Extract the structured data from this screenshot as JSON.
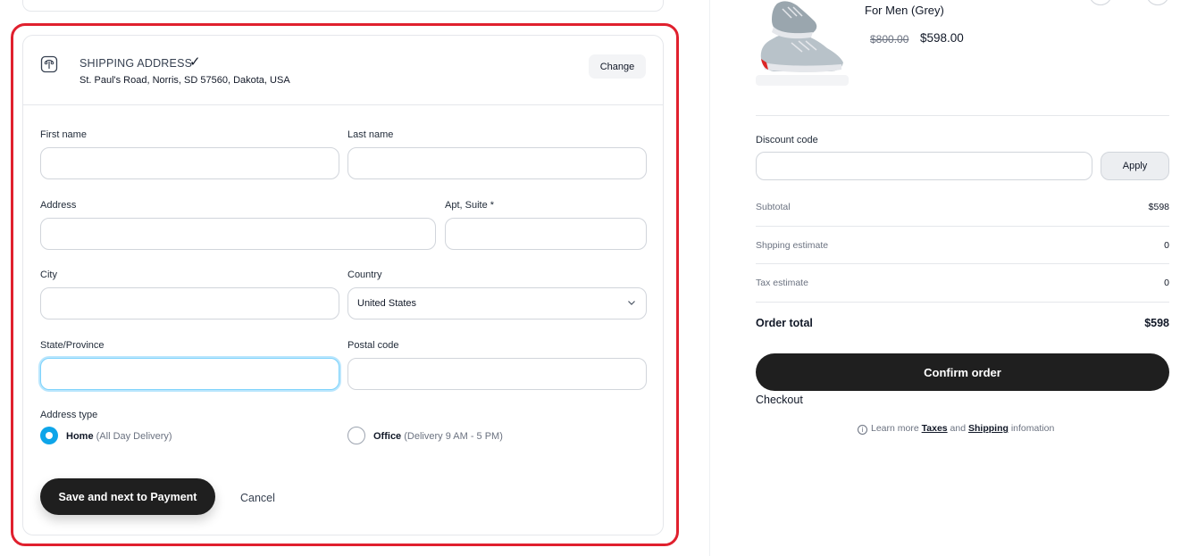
{
  "shipping": {
    "title": "SHIPPING ADDRESS",
    "check": "✓",
    "address": "St. Paul's Road, Norris, SD 57560, Dakota, USA",
    "change_label": "Change"
  },
  "form": {
    "first_name_label": "First name",
    "last_name_label": "Last name",
    "address_label": "Address",
    "apt_label": "Apt, Suite *",
    "city_label": "City",
    "country_label": "Country",
    "country_value": "United States",
    "state_label": "State/Province",
    "postal_label": "Postal code",
    "address_type_label": "Address type",
    "home_label": "Home",
    "home_sub": "(All Day Delivery)",
    "office_label": "Office",
    "office_sub": "(Delivery 9 AM - 5 PM)",
    "save_label": "Save and next to Payment",
    "cancel_label": "Cancel"
  },
  "product": {
    "name": "For Men (Grey)",
    "old_price": "$800.00",
    "new_price": "$598.00"
  },
  "summary": {
    "discount_label": "Discount code",
    "apply_label": "Apply",
    "subtotal_label": "Subtotal",
    "subtotal_value": "$598",
    "shipping_label": "Shpping estimate",
    "shipping_value": "0",
    "tax_label": "Tax estimate",
    "tax_value": "0",
    "total_label": "Order total",
    "total_value": "$598",
    "confirm_label": "Confirm order",
    "checkout_label": "Checkout",
    "learn_prefix": "Learn more",
    "taxes_link": "Taxes",
    "and_text": "and",
    "shipping_link": "Shipping",
    "learn_suffix": "infomation"
  },
  "colors": {
    "highlight": "#e0202e",
    "primary_button": "#1f1f1f",
    "radio_selected": "#0ea5e9"
  }
}
